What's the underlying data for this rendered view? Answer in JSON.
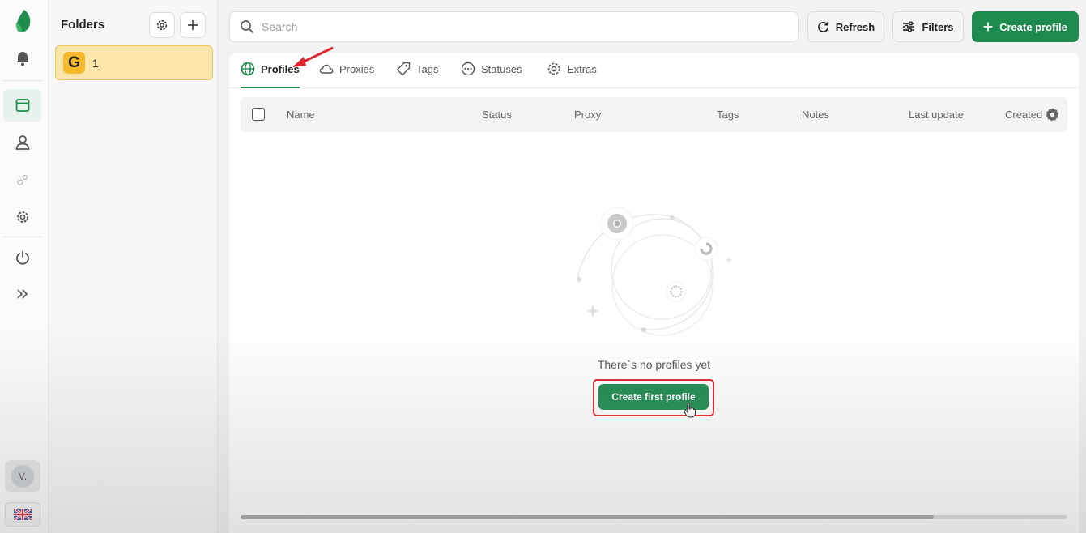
{
  "sidebar_rail": {
    "items": [
      {
        "name": "notifications",
        "icon": "bell-icon"
      },
      {
        "name": "profiles",
        "icon": "browser-window-icon",
        "active": true
      },
      {
        "name": "team",
        "icon": "user-icon"
      },
      {
        "name": "automation",
        "icon": "gears-icon"
      },
      {
        "name": "settings",
        "icon": "gear-icon"
      },
      {
        "name": "logout",
        "icon": "power-icon"
      },
      {
        "name": "expand",
        "icon": "double-chevron-right-icon"
      }
    ],
    "user_initial": "V.",
    "language_flag": "uk-flag-icon"
  },
  "folders": {
    "title": "Folders",
    "items": [
      {
        "logo_letter": "G",
        "name": "1"
      }
    ]
  },
  "toolbar": {
    "search_placeholder": "Search",
    "refresh_label": "Refresh",
    "filters_label": "Filters",
    "create_label": "Create profile"
  },
  "tabs": [
    {
      "label": "Profiles",
      "active": true
    },
    {
      "label": "Proxies"
    },
    {
      "label": "Tags"
    },
    {
      "label": "Statuses"
    },
    {
      "label": "Extras"
    }
  ],
  "table": {
    "columns": [
      "Name",
      "Status",
      "Proxy",
      "Tags",
      "Notes",
      "Last update",
      "Created"
    ]
  },
  "empty_state": {
    "message": "There`s no profiles yet",
    "cta_label": "Create first profile"
  },
  "colors": {
    "accent": "#1d8a4e",
    "folder_bg": "#fbe6aa",
    "highlight": "#e0242e"
  }
}
